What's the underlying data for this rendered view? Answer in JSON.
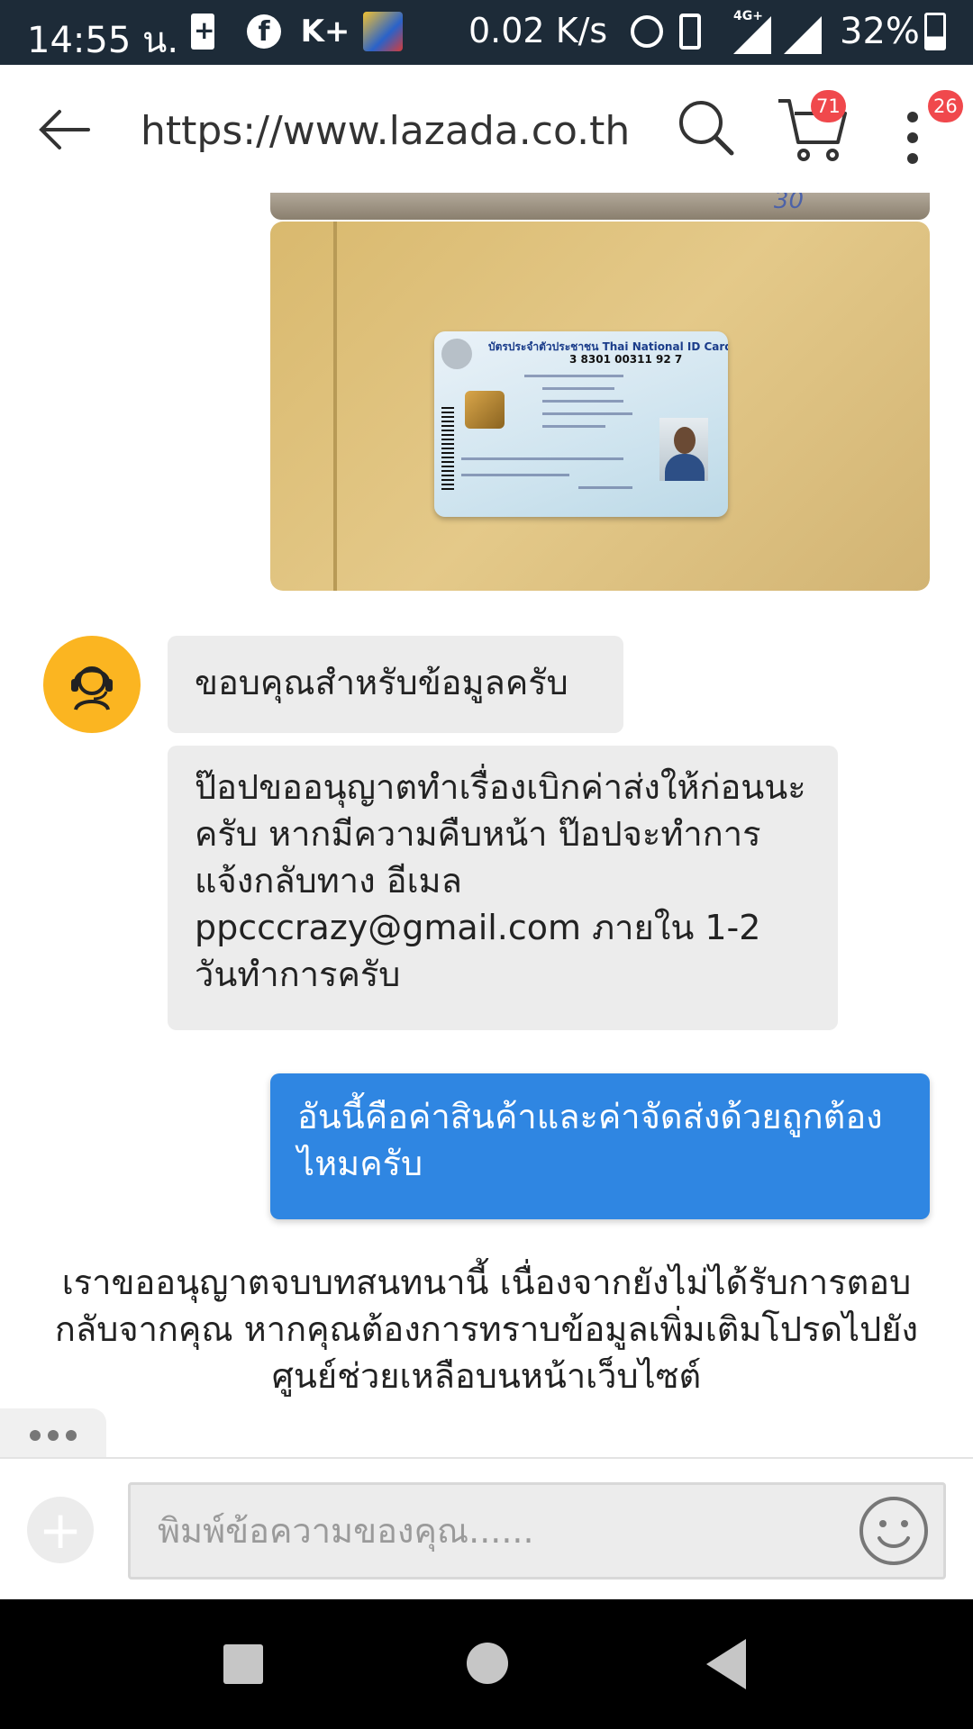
{
  "status_bar": {
    "time": "14:55 น.",
    "net_speed": "0.02 K/s",
    "network_type": "4G+",
    "battery_pct": "32%",
    "icons": [
      "battery-saver-icon",
      "facebook-icon",
      "k-plus-icon",
      "game-app-icon",
      "alarm-icon",
      "vibrate-icon",
      "signal-icon",
      "signal-icon",
      "battery-icon"
    ]
  },
  "header": {
    "url": "https://www.lazada.co.th",
    "cart_badge": "71",
    "more_badge": "26",
    "icons": [
      "back-arrow-icon",
      "search-icon",
      "cart-icon",
      "more-vert-icon"
    ]
  },
  "chat": {
    "id_card": {
      "title": "บัตรประจำตัวประชาชน Thai National ID Card",
      "number": "3 8301 00311 92 7"
    },
    "agent_messages": [
      "ขอบคุณสำหรับข้อมูลครับ",
      "ป๊อปขออนุญาตทำเรื่องเบิกค่าส่งให้ก่อนนะครับ หากมีความคืบหน้า ป๊อปจะทำการแจ้งกลับทาง อีเมล ppcccrazy@gmail.com ภายใน 1-2 วันทำการครับ"
    ],
    "user_message": "อันนี้คือค่าสินค้าและค่าจัดส่งด้วยถูกต้องไหมครับ",
    "system_message": "เราขออนุญาตจบบทสนทนานี้ เนื่องจากยังไม่ได้รับการตอบกลับจากคุณ หากคุณต้องการทราบข้อมูลเพิ่มเติมโปรดไปยังศูนย์ช่วยเหลือบนหน้าเว็บไซต์"
  },
  "input_bar": {
    "placeholder": "พิมพ์ข้อความของคุณ......",
    "value": ""
  },
  "colors": {
    "status_bar_bg": "#1d2b38",
    "user_bubble": "#2f86e2",
    "agent_bubble": "#ececec",
    "avatar_bg": "#fbb521",
    "badge": "#f0484c"
  }
}
